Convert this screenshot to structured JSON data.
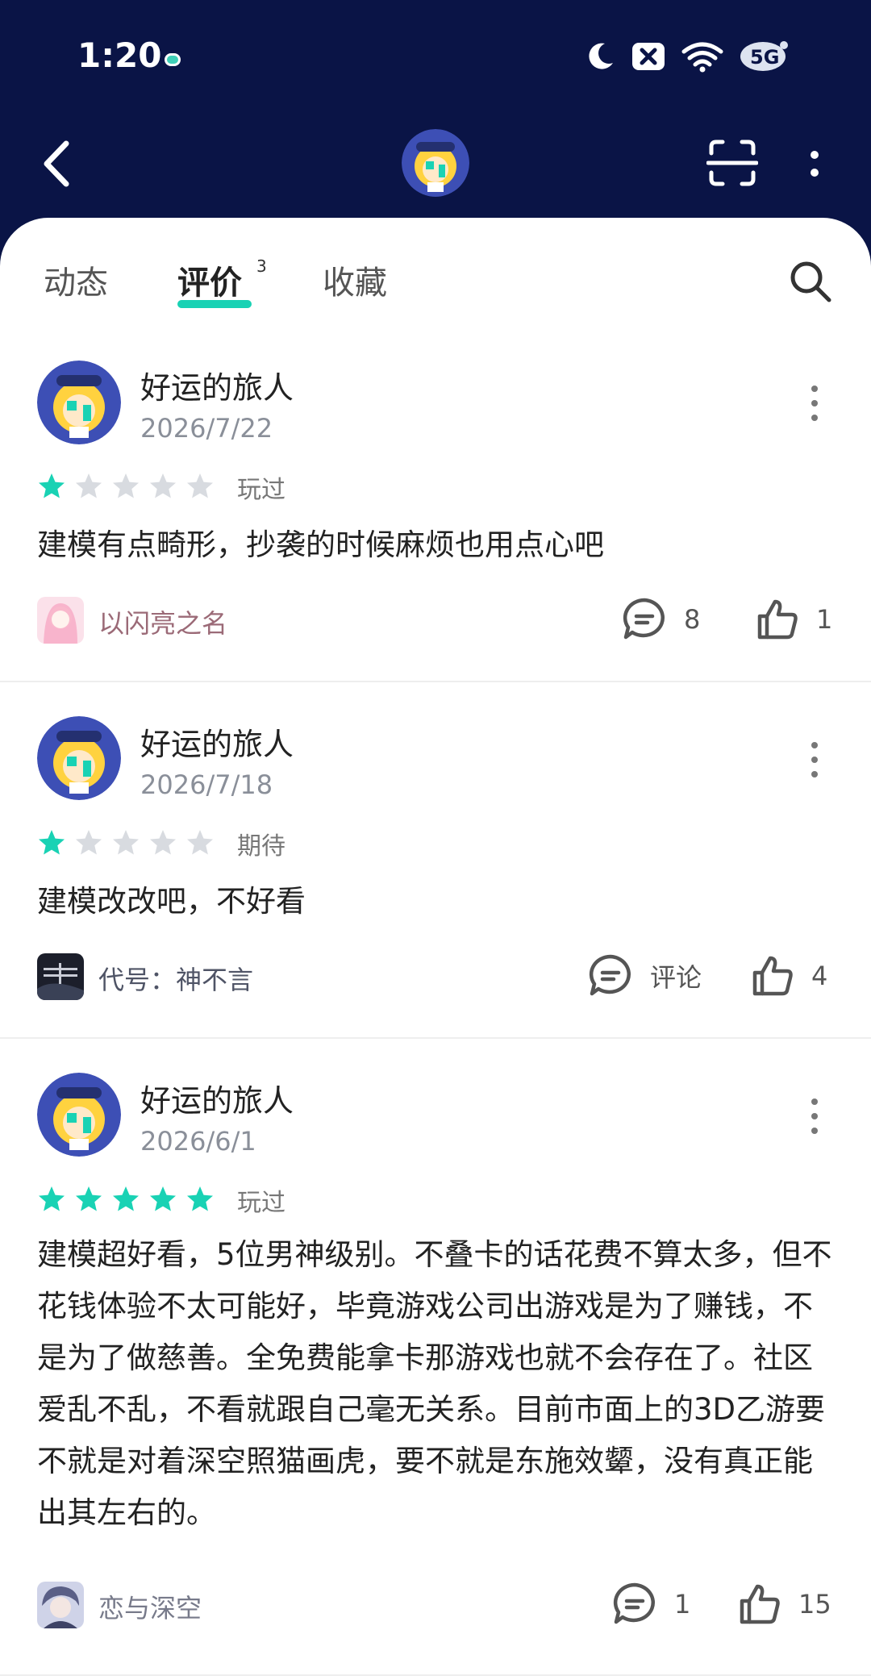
{
  "status_bar": {
    "time": "1:20",
    "icons": [
      "moon-icon",
      "no-sim-icon",
      "wifi-icon",
      "5g-icon"
    ]
  },
  "nav": {
    "back_icon": "chevron-left-icon",
    "scan_icon": "scan-icon",
    "more_icon": "more-vertical-icon"
  },
  "tabs": [
    {
      "label": "动态",
      "active": false
    },
    {
      "label": "评价",
      "active": true,
      "badge": "3"
    },
    {
      "label": "收藏",
      "active": false
    }
  ],
  "colors": {
    "header_bg": "#0a1446",
    "accent": "#19d2b4",
    "star_empty": "#d8dbe0"
  },
  "reviews": [
    {
      "username": "好运的旅人",
      "date": "2026/7/22",
      "rating": 1,
      "status": "玩过",
      "content": "建模有点畸形，抄袭的时候麻烦也用点心吧",
      "game": "以闪亮之名",
      "comments": "8",
      "likes": "1"
    },
    {
      "username": "好运的旅人",
      "date": "2026/7/18",
      "rating": 1,
      "status": "期待",
      "content": "建模改改吧，不好看",
      "game": "代号：神不言",
      "comments": "评论",
      "likes": "4"
    },
    {
      "username": "好运的旅人",
      "date": "2026/6/1",
      "rating": 5,
      "status": "玩过",
      "content": "建模超好看，5位男神级别。不叠卡的话花费不算太多，但不花钱体验不太可能好，毕竟游戏公司出游戏是为了赚钱，不是为了做慈善。全免费能拿卡那游戏也就不会存在了。社区爱乱不乱，不看就跟自己毫无关系。目前市面上的3D乙游要不就是对着深空照猫画虎，要不就是东施效颦，没有真正能出其左右的。",
      "game": "恋与深空",
      "comments": "1",
      "likes": "15"
    }
  ]
}
